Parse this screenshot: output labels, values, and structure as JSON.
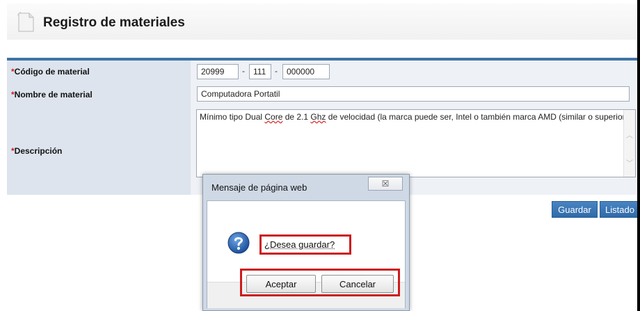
{
  "page": {
    "title": "Registro de materiales"
  },
  "form": {
    "required_mark": "*",
    "codigo": {
      "label": "Código de material",
      "part1": "20999",
      "part2": "111",
      "part3": "000000",
      "separator": "-"
    },
    "nombre": {
      "label": "Nombre de material",
      "value": "Computadora Portatil"
    },
    "descripcion": {
      "label": "Descripción",
      "text_a": "Mínimo tipo Dual ",
      "text_core": "Core",
      "text_b": " de 2.1 ",
      "text_ghz": "Ghz",
      "text_c": " de velocidad (la marca puede ser, Intel o también marca AMD (similar o superior)."
    }
  },
  "actions": {
    "guardar": "Guardar",
    "listado": "Listado"
  },
  "dialog": {
    "title": "Mensaje de página web",
    "close_glyph": "☒",
    "message": "¿Desea guardar?",
    "accept": "Aceptar",
    "cancel": "Cancelar"
  },
  "colors": {
    "header_rule": "#3f74a6",
    "label_bg": "#dde4ee",
    "button_blue": "#2f6aa9",
    "highlight_red": "#cc1c1c"
  },
  "icons": {
    "header": "document-page-icon",
    "dialog": "question-mark-icon"
  }
}
